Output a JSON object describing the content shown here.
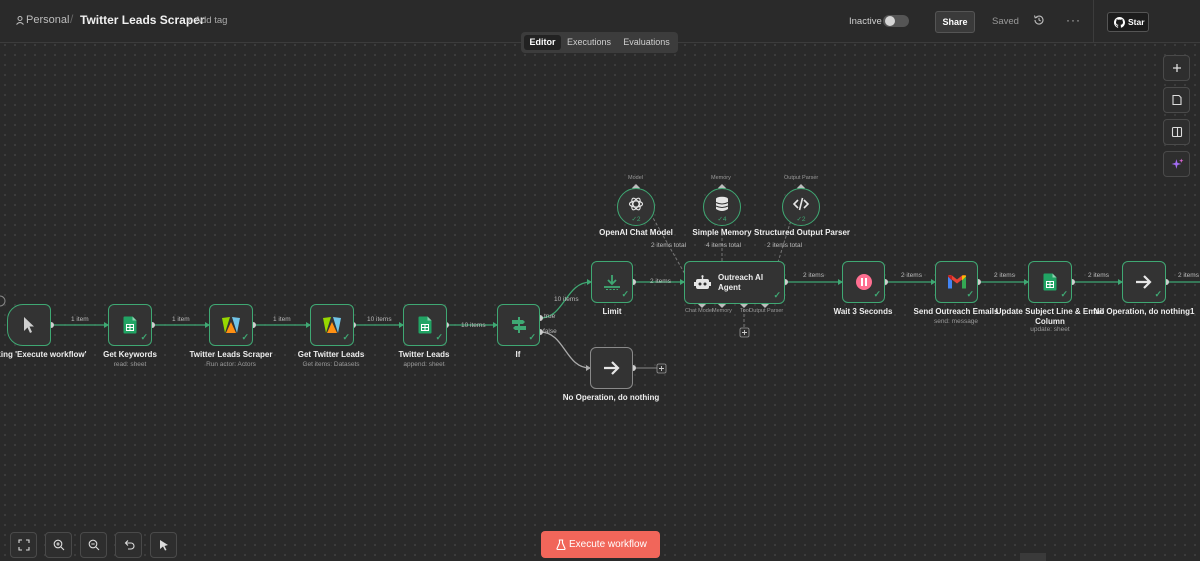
{
  "header": {
    "breadcrumb_root": "Personal",
    "workflow_title": "Twitter Leads Scraper",
    "add_tag": "+ Add tag",
    "status_label": "Inactive",
    "share_label": "Share",
    "saved_label": "Saved",
    "star_label": "Star",
    "icons": [
      "user-icon",
      "history-icon",
      "more-icon",
      "github-icon"
    ]
  },
  "tabs": [
    "Editor",
    "Executions",
    "Evaluations"
  ],
  "active_tab": "Editor",
  "right_toolbar_icons": [
    "plus-icon",
    "sticky-note-icon",
    "panel-icon",
    "sparkle-icon"
  ],
  "bottom_toolbar_icons": [
    "fit-view-icon",
    "zoom-in-icon",
    "zoom-out-icon",
    "undo-icon",
    "cursor-icon"
  ],
  "execute_label": "Execute workflow",
  "nodes": {
    "trigger": {
      "label": "en clicking 'Execute workflow'",
      "icon": "cursor-icon"
    },
    "get_keywords": {
      "label": "Get Keywords",
      "sub": "read: sheet",
      "icon": "google-sheets-icon"
    },
    "scraper": {
      "label": "Twitter Leads Scraper",
      "sub": "Run actor: Actors",
      "icon": "apify-icon"
    },
    "get_leads": {
      "label": "Get Twitter Leads",
      "sub": "Get items: Datasets",
      "icon": "apify-icon"
    },
    "twitter_leads": {
      "label": "Twitter Leads",
      "sub": "append: sheet",
      "icon": "google-sheets-icon"
    },
    "if": {
      "label": "If",
      "icon": "branch-icon"
    },
    "noop_false": {
      "label": "No Operation, do nothing",
      "icon": "arrow-right-icon"
    },
    "limit": {
      "label": "Limit",
      "icon": "limit-icon"
    },
    "agent": {
      "label": "Outreach AI Agent",
      "icon": "robot-icon"
    },
    "openai": {
      "label": "OpenAI Chat Model",
      "icon": "openai-icon",
      "count": "2"
    },
    "memory": {
      "label": "Simple Memory",
      "icon": "database-icon",
      "count": "4"
    },
    "parser": {
      "label": "Structured Output Parser",
      "icon": "code-icon",
      "count": "2"
    },
    "wait": {
      "label": "Wait 3 Seconds",
      "icon": "pause-icon"
    },
    "gmail": {
      "label": "Send Outreach Emails",
      "sub": "send: message",
      "icon": "gmail-icon"
    },
    "update": {
      "label": "Update Subject Line & Email Column",
      "sub": "update: sheet",
      "icon": "google-sheets-icon"
    },
    "noop1": {
      "label": "No Operation, do nothing1",
      "icon": "arrow-right-icon"
    }
  },
  "edges": {
    "e1": "1 item",
    "e2": "1 item",
    "e3": "1 item",
    "e4": "10 items",
    "e5": "10 items",
    "if_true": "true",
    "if_false": "false",
    "e_limit": "10 items",
    "e_agent": "2 items",
    "e_wait": "2 items",
    "e_gmail": "2 items",
    "e_update": "2 items",
    "e_noop1": "2 items",
    "e_out": "2 items",
    "model_total": "2 items total",
    "memory_total": "4 items total",
    "parser_total": "2 items total"
  },
  "ports": {
    "model_top": "Model",
    "memory_top": "Memory",
    "parser_top": "Output Parser",
    "agent_model": "Chat Model",
    "agent_memory": "Memory",
    "agent_tool": "Tool",
    "agent_parser": "Output Parser"
  }
}
